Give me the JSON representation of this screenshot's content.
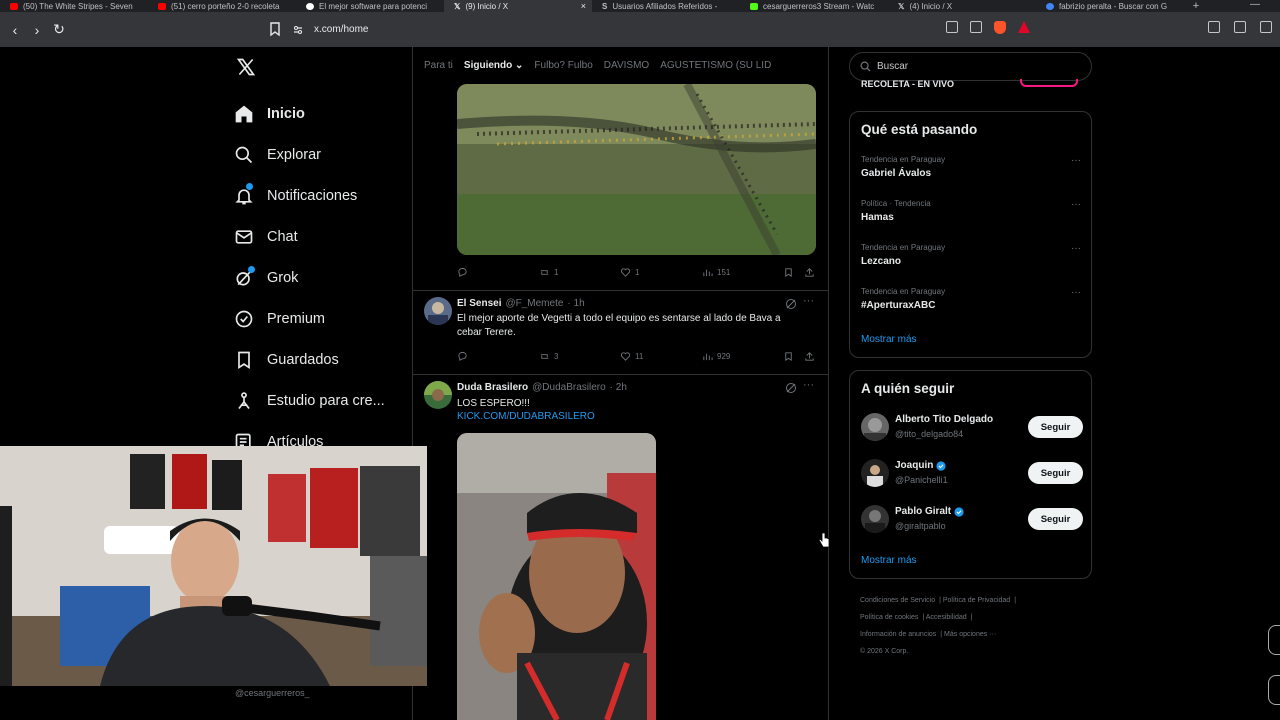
{
  "browser": {
    "tabs": [
      {
        "title": "(50) The White Stripes - Seven",
        "color": "#ff0000"
      },
      {
        "title": "(51) cerro porteño 2-0 recoleta",
        "color": "#ff0000"
      },
      {
        "title": "El mejor software para potenci",
        "color": "#ffffff"
      },
      {
        "title": "(9) Inicio / X",
        "color": "#ffffff",
        "active": true
      },
      {
        "title": "Usuarios Afiliados Referidos - ",
        "color": "#bdc1c6"
      },
      {
        "title": "cesarguerreros3 Stream - Watc",
        "color": "#53fc18"
      },
      {
        "title": "(4) Inicio / X",
        "color": "#ffffff"
      },
      {
        "title": "fabrizio peralta - Buscar con G",
        "color": "#4285f4"
      }
    ],
    "tab_close": "×",
    "new_tab": "+",
    "minimize": "—",
    "url": "x.com/home"
  },
  "nav": {
    "items": [
      {
        "label": "Inicio",
        "icon": "home-icon"
      },
      {
        "label": "Explorar",
        "icon": "search-icon"
      },
      {
        "label": "Notificaciones",
        "icon": "bell-icon"
      },
      {
        "label": "Chat",
        "icon": "mail-icon"
      },
      {
        "label": "Grok",
        "icon": "grok-icon"
      },
      {
        "label": "Premium",
        "icon": "verified-icon"
      },
      {
        "label": "Guardados",
        "icon": "bookmark-icon"
      },
      {
        "label": "Estudio para cre...",
        "icon": "studio-icon"
      },
      {
        "label": "Artículos",
        "icon": "articles-icon"
      }
    ]
  },
  "feed_tabs": [
    "Para ti",
    "Siguiendo",
    "Fulbo? Fulbo",
    "DAVISMO",
    "AGUSTETISMO (SU LID"
  ],
  "feed_tab_chevron": "⌄",
  "tweets": [
    {
      "actions": {
        "replies": "",
        "reposts": "1",
        "likes": "1",
        "views": "151"
      }
    },
    {
      "name": "El Sensei",
      "handle": "@F_Memete",
      "time": "· 1h",
      "text": "El mejor aporte de Vegetti a todo el equipo es sentarse al lado de Bava a cebar Terere.",
      "actions": {
        "replies": "",
        "reposts": "3",
        "likes": "11",
        "views": "929"
      }
    },
    {
      "name": "Duda Brasilero",
      "handle": "@DudaBrasilero",
      "time": "· 2h",
      "text": "LOS ESPERO!!!",
      "link": "KICK.COM/DUDABRASILERO"
    }
  ],
  "more_glyph": "···",
  "search": {
    "placeholder": "Buscar"
  },
  "live_banner": "RECOLETA - EN VIVO",
  "trends": {
    "title": "Qué está pasando",
    "items": [
      {
        "context": "Tendencia en Paraguay",
        "topic": "Gabriel Ávalos"
      },
      {
        "context": "Política · Tendencia",
        "topic": "Hamas"
      },
      {
        "context": "Tendencia en Paraguay",
        "topic": "Lezcano"
      },
      {
        "context": "Tendencia en Paraguay",
        "topic": "#AperturaxABC"
      }
    ],
    "show_more": "Mostrar más"
  },
  "who_to_follow": {
    "title": "A quién seguir",
    "items": [
      {
        "name": "Alberto Tito Delgado",
        "handle": "@tito_delgado84",
        "verified": false
      },
      {
        "name": "Joaquin",
        "handle": "@Panichelli1",
        "verified": true
      },
      {
        "name": "Pablo Giralt",
        "handle": "@giraltpablo",
        "verified": true
      }
    ],
    "follow_label": "Seguir",
    "show_more": "Mostrar más"
  },
  "footer": {
    "links": [
      "Condiciones de Servicio",
      "Política de Privacidad",
      "Política de cookies",
      "Accesibilidad",
      "Información de anuncios",
      "Más opciones ···"
    ],
    "copyright": "© 2026 X Corp."
  },
  "account": {
    "handle": "@cesarguerreros_"
  },
  "colors": {
    "accent": "#1d9bf0",
    "background": "#000000",
    "border": "#2f3336",
    "muted": "#71767b"
  }
}
